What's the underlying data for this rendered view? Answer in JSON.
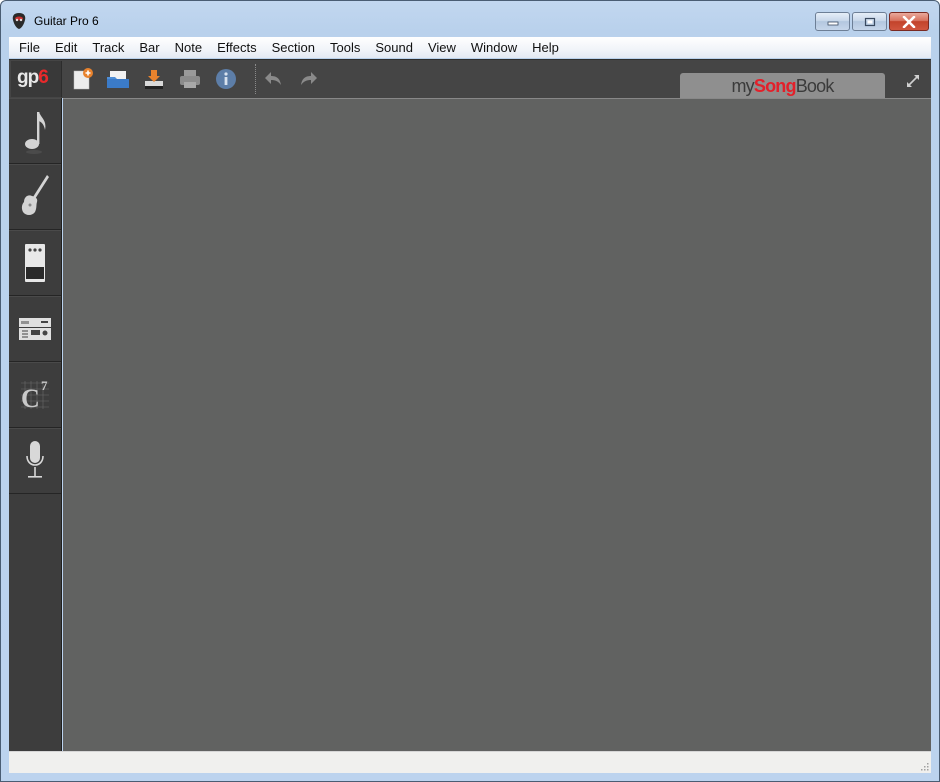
{
  "window": {
    "title": "Guitar Pro 6",
    "controls": {
      "minimize": "minimize",
      "maximize": "maximize",
      "close": "close"
    }
  },
  "menu": {
    "items": [
      {
        "label": "File"
      },
      {
        "label": "Edit"
      },
      {
        "label": "Track"
      },
      {
        "label": "Bar"
      },
      {
        "label": "Note"
      },
      {
        "label": "Effects"
      },
      {
        "label": "Section"
      },
      {
        "label": "Tools"
      },
      {
        "label": "Sound"
      },
      {
        "label": "View"
      },
      {
        "label": "Window"
      },
      {
        "label": "Help"
      }
    ]
  },
  "toolbar": {
    "logo": {
      "prefix": "gp",
      "version": "6"
    },
    "buttons": [
      {
        "name": "new-file",
        "icon": "new-document-icon"
      },
      {
        "name": "open-file",
        "icon": "folder-icon"
      },
      {
        "name": "save-file",
        "icon": "download-tray-icon"
      },
      {
        "name": "print",
        "icon": "printer-icon"
      },
      {
        "name": "info",
        "icon": "info-icon"
      },
      {
        "name": "undo",
        "icon": "undo-arrow-icon"
      },
      {
        "name": "redo",
        "icon": "redo-arrow-icon"
      }
    ],
    "songbook": {
      "my": "my",
      "song": "Song",
      "book": "Book"
    },
    "expand_icon": "expand-arrows-icon"
  },
  "sidebar": {
    "items": [
      {
        "name": "score-panel",
        "icon": "music-note-icon"
      },
      {
        "name": "instrument-panel",
        "icon": "guitar-icon"
      },
      {
        "name": "effects-pedal-panel",
        "icon": "stompbox-pedal-icon"
      },
      {
        "name": "mixer-panel",
        "icon": "rack-device-icon"
      },
      {
        "name": "chord-panel",
        "icon": "chord-diagram-icon",
        "label": "C",
        "superscript": "7"
      },
      {
        "name": "microphone-panel",
        "icon": "microphone-icon"
      }
    ]
  },
  "colors": {
    "toolbar_bg": "#454545",
    "canvas_bg": "#616261",
    "sidebar_bg": "#3d3d3d",
    "brand_red": "#e3202a",
    "songbook_tab": "#8f8f8f"
  },
  "statusbar": {
    "text": ""
  }
}
